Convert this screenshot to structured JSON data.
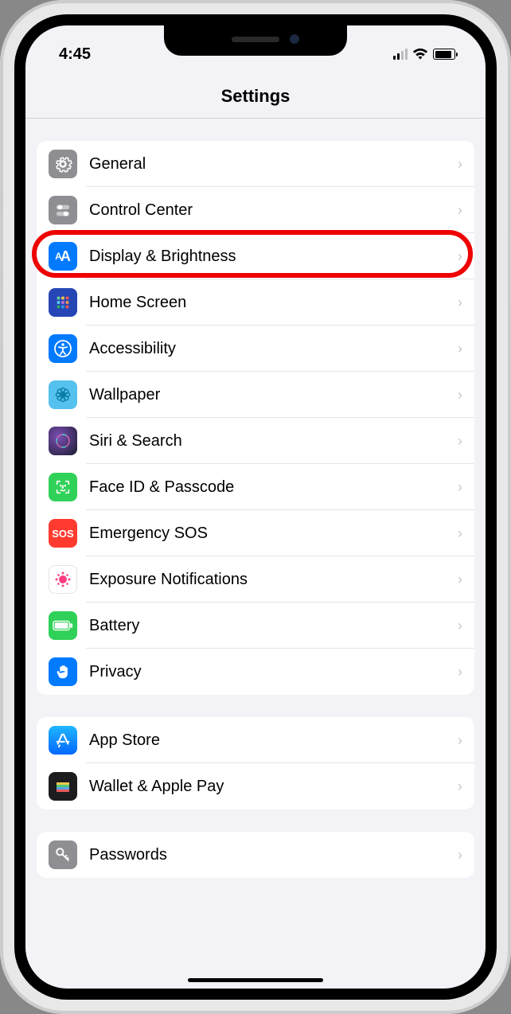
{
  "status": {
    "time": "4:45"
  },
  "header": {
    "title": "Settings"
  },
  "groups": [
    {
      "rows": [
        {
          "id": "general",
          "label": "General",
          "icon": "gear-icon",
          "color": "#8e8e93"
        },
        {
          "id": "control-center",
          "label": "Control Center",
          "icon": "toggles-icon",
          "color": "#8e8e93"
        },
        {
          "id": "display-brightness",
          "label": "Display & Brightness",
          "icon": "textsize-icon",
          "color": "#007aff",
          "highlighted": true
        },
        {
          "id": "home-screen",
          "label": "Home Screen",
          "icon": "grid-icon",
          "color": "#3355cc"
        },
        {
          "id": "accessibility",
          "label": "Accessibility",
          "icon": "accessibility-icon",
          "color": "#007aff"
        },
        {
          "id": "wallpaper",
          "label": "Wallpaper",
          "icon": "flower-icon",
          "color": "#55c1ef"
        },
        {
          "id": "siri-search",
          "label": "Siri & Search",
          "icon": "siri-icon",
          "color": "#1b1b2e"
        },
        {
          "id": "faceid-passcode",
          "label": "Face ID & Passcode",
          "icon": "faceid-icon",
          "color": "#30d158"
        },
        {
          "id": "emergency-sos",
          "label": "Emergency SOS",
          "icon": "sos-icon",
          "color": "#ff3b30"
        },
        {
          "id": "exposure-notifications",
          "label": "Exposure Notifications",
          "icon": "exposure-icon",
          "color": "#ffffff"
        },
        {
          "id": "battery",
          "label": "Battery",
          "icon": "battery-icon",
          "color": "#30d158"
        },
        {
          "id": "privacy",
          "label": "Privacy",
          "icon": "hand-icon",
          "color": "#007aff"
        }
      ]
    },
    {
      "rows": [
        {
          "id": "app-store",
          "label": "App Store",
          "icon": "appstore-icon",
          "color": "#1f8fff"
        },
        {
          "id": "wallet-applepay",
          "label": "Wallet & Apple Pay",
          "icon": "wallet-icon",
          "color": "#1c1c1e"
        }
      ]
    },
    {
      "rows": [
        {
          "id": "passwords",
          "label": "Passwords",
          "icon": "key-icon",
          "color": "#8e8e93"
        }
      ]
    }
  ]
}
